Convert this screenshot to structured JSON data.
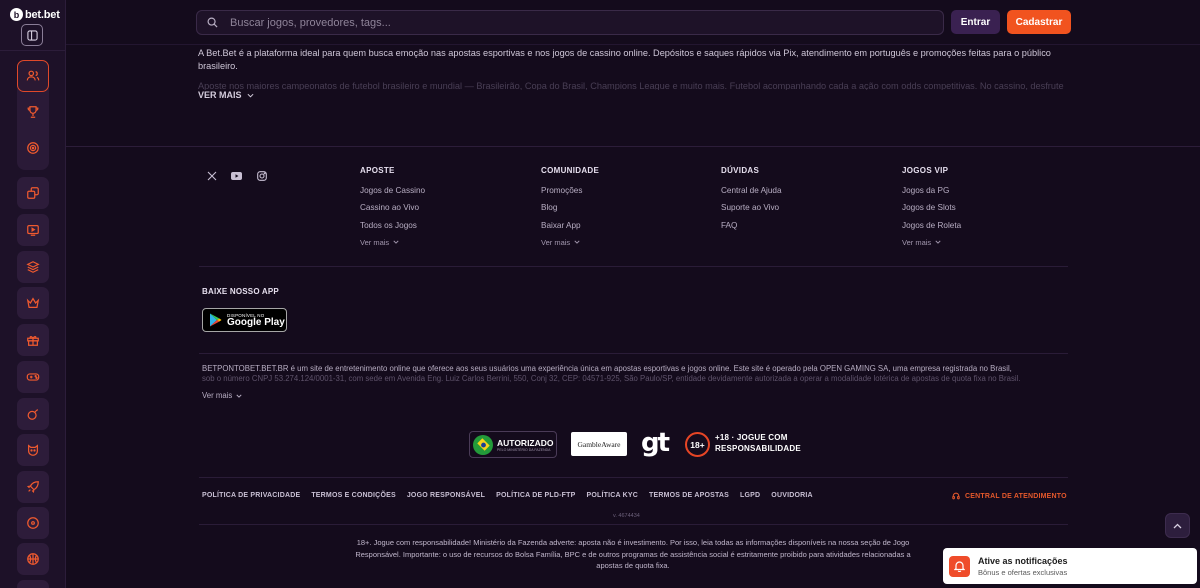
{
  "brand": {
    "name": "bet.bet"
  },
  "search": {
    "placeholder": "Buscar jogos, provedores, tags..."
  },
  "header": {
    "login_label": "Entrar",
    "register_label": "Cadastrar"
  },
  "intro": {
    "text": "A Bet.Bet é a plataforma ideal para quem busca emoção nas apostas esportivas e nos jogos de cassino online. Depósitos e saques rápidos via Pix, atendimento em português e promoções feitas para o público brasileiro.",
    "faded_text": "Aposte nos maiores campeonatos de futebol brasileiro e mundial — Brasileirão, Copa do Brasil, Champions League e muito mais. Futebol acompanhando cada a ação com odds competitivas. No cassino, desfrute",
    "more_label": "VER MAIS"
  },
  "footer": {
    "columns": [
      {
        "title": "APOSTE",
        "links": [
          "Jogos de Cassino",
          "Cassino ao Vivo",
          "Todos os Jogos"
        ],
        "more": "Ver mais"
      },
      {
        "title": "COMUNIDADE",
        "links": [
          "Promoções",
          "Blog",
          "Baixar App"
        ],
        "more": "Ver mais"
      },
      {
        "title": "DÚVIDAS",
        "links": [
          "Central de Ajuda",
          "Suporte ao Vivo",
          "FAQ"
        ],
        "more": null
      },
      {
        "title": "JOGOS VIP",
        "links": [
          "Jogos da PG",
          "Jogos de Slots",
          "Jogos de Roleta"
        ],
        "more": "Ver mais"
      }
    ],
    "app": {
      "title": "BAIXE NOSSO APP",
      "store_small": "DISPONÍVEL NO",
      "store_big": "Google Play"
    },
    "legal": {
      "text": "BETPONTOBET.BET.BR é um site de entretenimento online que oferece aos seus usuários uma experiência única em apostas esportivas e jogos online. Este site é operado pela OPEN GAMING SA, uma empresa registrada no Brasil,",
      "faded_text": "sob o número CNPJ 53.274.124/0001-31, com sede em Avenida Eng. Luiz Carlos Berrini, 550, Conj 32, CEP: 04571-925, São Paulo/SP, entidade devidamente autorizada a operar a modalidade lotérica de apostas de quota fixa no Brasil.",
      "more_label": "Ver mais"
    },
    "badges": {
      "authorized_big": "AUTORIZADO",
      "authorized_small": "PELO MINISTÉRIO DA FAZENDA",
      "gamble_aware": "GambleAware",
      "gt": "gt",
      "age": "18+",
      "age_line1": "+18 · JOGUE COM",
      "age_line2": "RESPONSABILIDADE"
    },
    "bottom_links": [
      "POLÍTICA DE PRIVACIDADE",
      "TERMOS E CONDIÇÕES",
      "JOGO RESPONSÁVEL",
      "POLÍTICA DE PLD-FTP",
      "POLÍTICA KYC",
      "TERMOS DE APOSTAS",
      "LGPD",
      "OUVIDORIA"
    ],
    "support_label": "CENTRAL DE ATENDIMENTO",
    "version": "v. 4674434",
    "disclaimer": "18+. Jogue com responsabilidade! Ministério da Fazenda adverte: aposta não é investimento. Por isso, leia todas as informações disponíveis na nossa seção de Jogo Responsável. Importante: o uso de recursos do Bolsa Família, BPC e de outros programas de assistência social é estritamente proibido para atividades relacionadas a apostas de quota fixa."
  },
  "notification": {
    "title": "Ative as notificações",
    "subtitle": "Bônus e ofertas exclusivas"
  },
  "colors": {
    "accent": "#f1531f",
    "background": "#140b1c",
    "sidebar": "#1d1128"
  }
}
